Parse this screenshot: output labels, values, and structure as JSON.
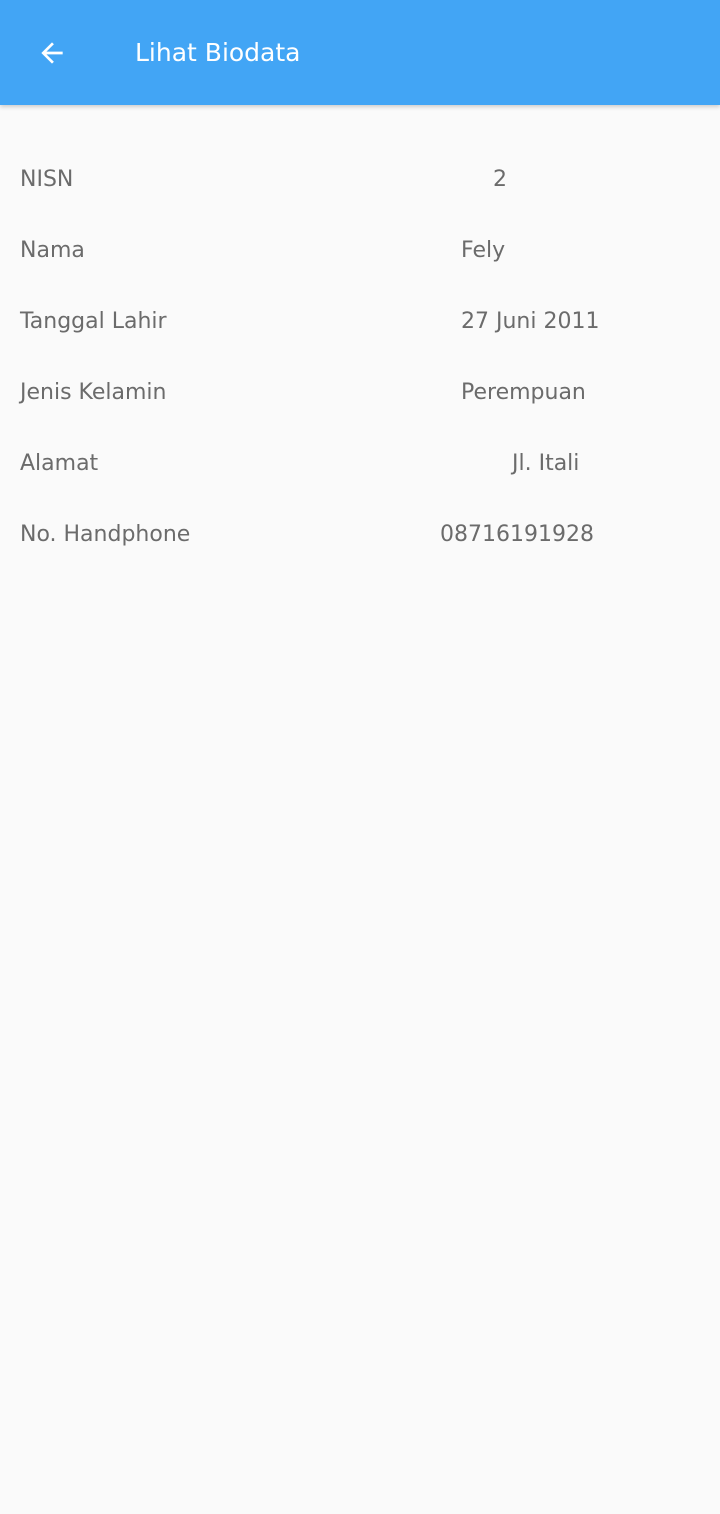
{
  "app_bar": {
    "title": "Lihat Biodata",
    "back_icon": "arrow-left-icon",
    "background_color": "#42a5f5",
    "text_color": "#ffffff"
  },
  "biodata": {
    "rows": [
      {
        "label": "NISN",
        "value": "2"
      },
      {
        "label": "Nama",
        "value": "Fely"
      },
      {
        "label": "Tanggal Lahir",
        "value": "27 Juni 2011"
      },
      {
        "label": "Jenis Kelamin",
        "value": "Perempuan"
      },
      {
        "label": "Alamat",
        "value": "Jl. Itali"
      },
      {
        "label": "No. Handphone",
        "value": "08716191928"
      }
    ],
    "text_color": "#6b6b6b",
    "background_color": "#fafafa"
  }
}
